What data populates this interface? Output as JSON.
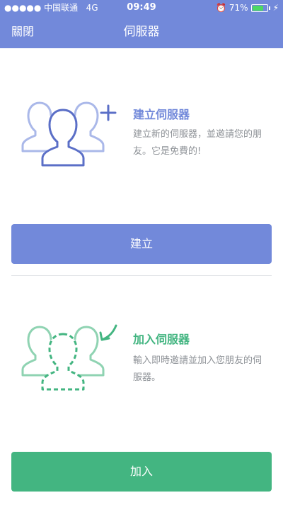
{
  "status_bar": {
    "signal": "●●●●● 中国联通",
    "network": "4G",
    "time": "09:49",
    "alarm_icon": "alarm-clock-icon",
    "battery": "71%",
    "battery_level": 0.71,
    "battery_color": "#4cd964"
  },
  "nav": {
    "close_label": "關閉",
    "title": "伺服器"
  },
  "create": {
    "title": "建立伺服器",
    "description": "建立新的伺服器，並邀請您的朋友。它是免費的!",
    "button_label": "建立",
    "accent": "#7289da",
    "icon": "group-add-icon"
  },
  "join": {
    "title": "加入伺服器",
    "description": "輸入即時邀請並加入您朋友的伺服器。",
    "button_label": "加入",
    "accent": "#43b581",
    "icon": "group-join-icon"
  }
}
